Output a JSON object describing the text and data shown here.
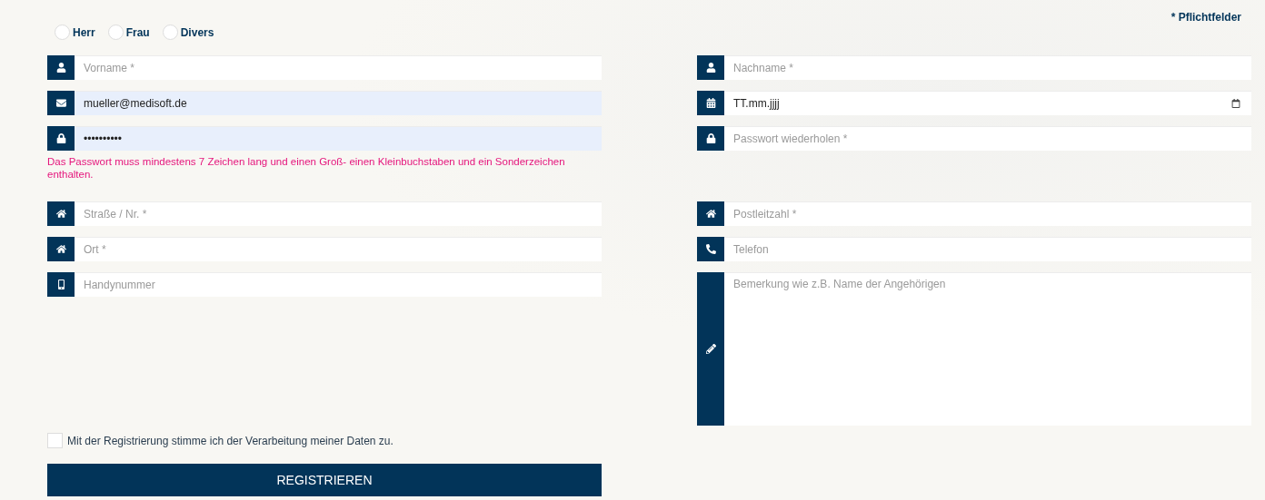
{
  "required_note": "* Pflichtfelder",
  "salutation": [
    {
      "label": "Herr",
      "selected": false
    },
    {
      "label": "Frau",
      "selected": false
    },
    {
      "label": "Divers",
      "selected": false
    }
  ],
  "left_column": [
    {
      "kind": "input",
      "placeholder": "Vorname *",
      "autofilled": false
    },
    {
      "kind": "input",
      "value": "mueller@medisoft.de",
      "autofilled": true
    },
    {
      "kind": "input",
      "value": "••••••••••",
      "autofilled": true
    },
    {
      "kind": "error",
      "text": "Das Passwort muss mindestens 7 Zeichen lang und einen Groß- einen Kleinbuchstaben und ein Sonderzeichen enthalten."
    },
    {
      "kind": "input",
      "placeholder": "Straße / Nr. *",
      "autofilled": false
    },
    {
      "kind": "input",
      "placeholder": "Ort *",
      "autofilled": false
    },
    {
      "kind": "input",
      "placeholder": "Handynummer",
      "autofilled": false
    }
  ],
  "right_column": [
    {
      "kind": "input",
      "placeholder": "Nachname *",
      "autofilled": false
    },
    {
      "kind": "date",
      "value": "TT.mm.jjjj",
      "autofilled": false
    },
    {
      "kind": "input",
      "placeholder": "Passwort wiederholen *",
      "autofilled": false
    },
    {
      "kind": "input",
      "placeholder": "Postleitzahl *",
      "autofilled": false
    },
    {
      "kind": "input",
      "placeholder": "Telefon",
      "autofilled": false
    },
    {
      "kind": "textarea",
      "placeholder": "Bemerkung wie z.B. Name der Angehörigen",
      "autofilled": false
    }
  ],
  "consent": {
    "label": "Mit der Registrierung stimme ich der Verarbeitung meiner Daten zu.",
    "checked": false
  },
  "submit": "REGISTRIEREN"
}
